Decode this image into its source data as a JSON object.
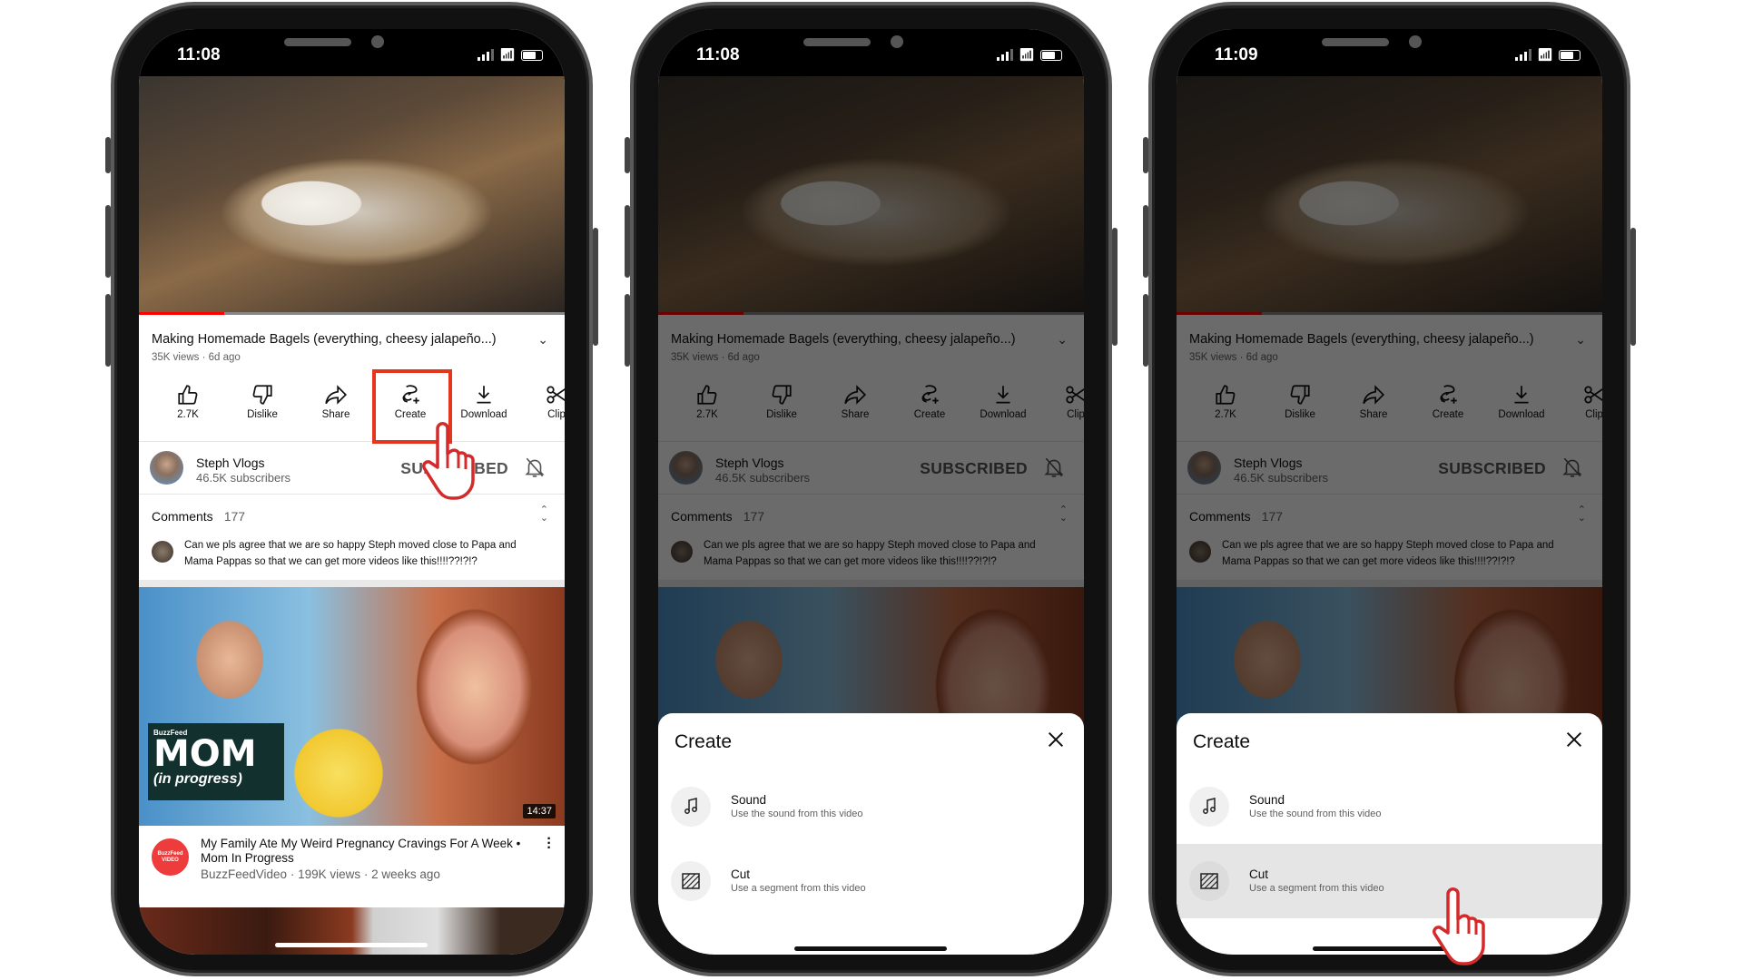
{
  "video": {
    "title": "Making Homemade Bagels (everything, cheesy jalapeño...)",
    "meta": "35K views · 6d ago",
    "progress_percent": 20,
    "actions": [
      {
        "label": "2.7K",
        "icon": "thumbs-up-icon"
      },
      {
        "label": "Dislike",
        "icon": "thumbs-down-icon"
      },
      {
        "label": "Share",
        "icon": "share-icon"
      },
      {
        "label": "Create",
        "icon": "create-icon"
      },
      {
        "label": "Download",
        "icon": "download-icon"
      },
      {
        "label": "Clip",
        "icon": "scissors-icon"
      }
    ]
  },
  "channel": {
    "name": "Steph Vlogs",
    "subscribers": "46.5K subscribers",
    "subscribe_label": "SUBSCRIBED"
  },
  "comments": {
    "label": "Comments",
    "count": "177",
    "top_comment": "Can we pls agree that we are so happy Steph moved close to Papa and Mama Pappas so that we can get more videos like this!!!!??!?!?"
  },
  "recommended": {
    "thumb_brand": "BuzzFeed",
    "thumb_logo": "MOM",
    "thumb_logo_sub": "(in progress)",
    "duration": "14:37",
    "avatar_text": "BuzzFeed VIDEO",
    "title": "My Family Ate My Weird Pregnancy Cravings For A Week • Mom In Progress",
    "meta": "BuzzFeedVideo · 199K views · 2 weeks ago"
  },
  "sheet": {
    "title": "Create",
    "items": [
      {
        "label": "Sound",
        "desc": "Use the sound from this video",
        "icon": "music-note-icon"
      },
      {
        "label": "Cut",
        "desc": "Use a segment from this video",
        "icon": "cut-segment-icon"
      }
    ]
  },
  "phones": [
    {
      "time": "11:08",
      "sheet_open": false,
      "highlight": "create-button",
      "cursor_on": "create-button"
    },
    {
      "time": "11:08",
      "sheet_open": true,
      "highlight": null,
      "cursor_on": null
    },
    {
      "time": "11:09",
      "sheet_open": true,
      "highlight": "cut",
      "cursor_on": "cut"
    }
  ],
  "colors": {
    "accent_red": "#ff0000",
    "highlight_box": "#e3361c"
  }
}
